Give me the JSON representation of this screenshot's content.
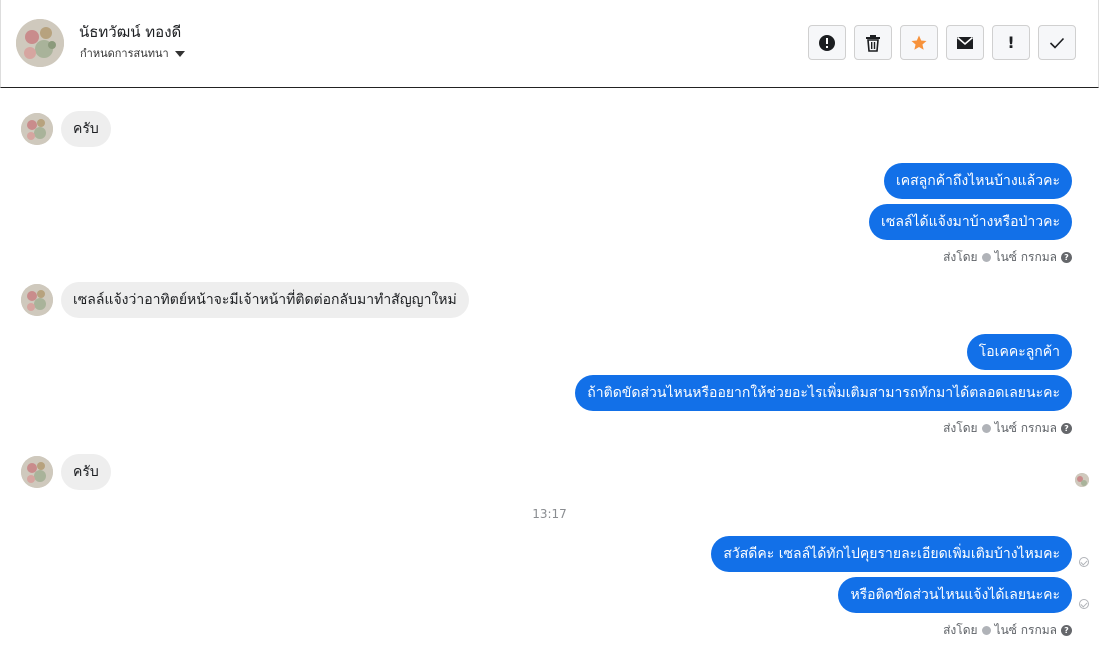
{
  "header": {
    "contact_name": "นัธทวัฒน์ ทองดี",
    "subtitle": "กำหนดการสนทนา",
    "actions": [
      {
        "icon": "alert-circle-icon"
      },
      {
        "icon": "trash-icon"
      },
      {
        "icon": "star-icon",
        "color": "#f7923b"
      },
      {
        "icon": "envelope-icon"
      },
      {
        "icon": "exclamation-icon",
        "label": "!"
      },
      {
        "icon": "check-icon"
      }
    ]
  },
  "messages": {
    "m1": "ครับ",
    "m2": "เคสลูกค้าถึงไหนบ้างแล้วคะ",
    "m3": "เซลล์ได้แจ้งมาบ้างหรือป่าวคะ",
    "m4": "เซลล์แจ้งว่าอาทิตย์หน้าจะมีเจ้าหน้าที่ติดต่อกลับมาทำสัญญาใหม่",
    "m5": "โอเคคะลูกค้า",
    "m6": "ถ้าติดขัดส่วนไหนหรืออยากให้ช่วยอะไรเพิ่มเติมสามารถทักมาได้ตลอดเลยนะคะ",
    "m7": "ครับ",
    "m8": "สวัสดีคะ เซลล์ได้ทักไปคุยรายละเอียดเพิ่มเติมบ้างไหมคะ",
    "m9": "หรือติดขัดส่วนไหนแจ้งได้เลยนะคะ"
  },
  "meta": {
    "sent_by_prefix": "ส่งโดย",
    "sent_by_name": "ไนซ์ กรกมล",
    "time_separator": "13:17"
  },
  "colors": {
    "outgoing_bubble": "#1270e8",
    "incoming_bubble": "#eeeeee"
  }
}
